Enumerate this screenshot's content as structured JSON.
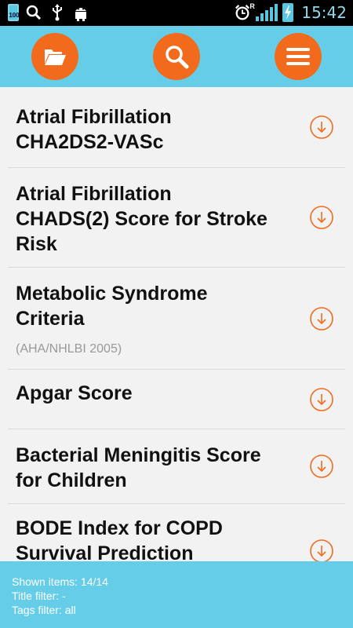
{
  "status_bar": {
    "battery_level": "100",
    "time": "15:42",
    "network_mark": "R",
    "icons": [
      "battery-icon",
      "search-icon",
      "usb-icon",
      "android-icon",
      "alarm-icon",
      "signal-icon",
      "charging-battery-icon"
    ]
  },
  "toolbar": {
    "buttons": [
      "folder-icon",
      "search-icon",
      "menu-icon"
    ],
    "accent_color": "#f26b1d",
    "bar_color": "#65cde8"
  },
  "list": {
    "items": [
      {
        "title_line1": "Atrial Fibrillation",
        "title_line2": "CHA2DS2-VASc"
      },
      {
        "title_line1": "Atrial Fibrillation",
        "title_line2": "CHADS(2) Score for Stroke",
        "title_line3": "Risk"
      },
      {
        "title_line1": "Metabolic Syndrome",
        "title_line2": "Criteria",
        "subtitle": "(AHA/NHLBI 2005)"
      },
      {
        "title_line1": "Apgar Score"
      },
      {
        "title_line1": "Bacterial Meningitis Score",
        "title_line2": "for Children"
      },
      {
        "title_line1": "BODE Index for COPD",
        "title_line2": "Survival Prediction"
      }
    ]
  },
  "footer": {
    "shown_items": "Shown items: 14/14",
    "title_filter": "Title filter: -",
    "tags_filter": "Tags filter: all"
  }
}
